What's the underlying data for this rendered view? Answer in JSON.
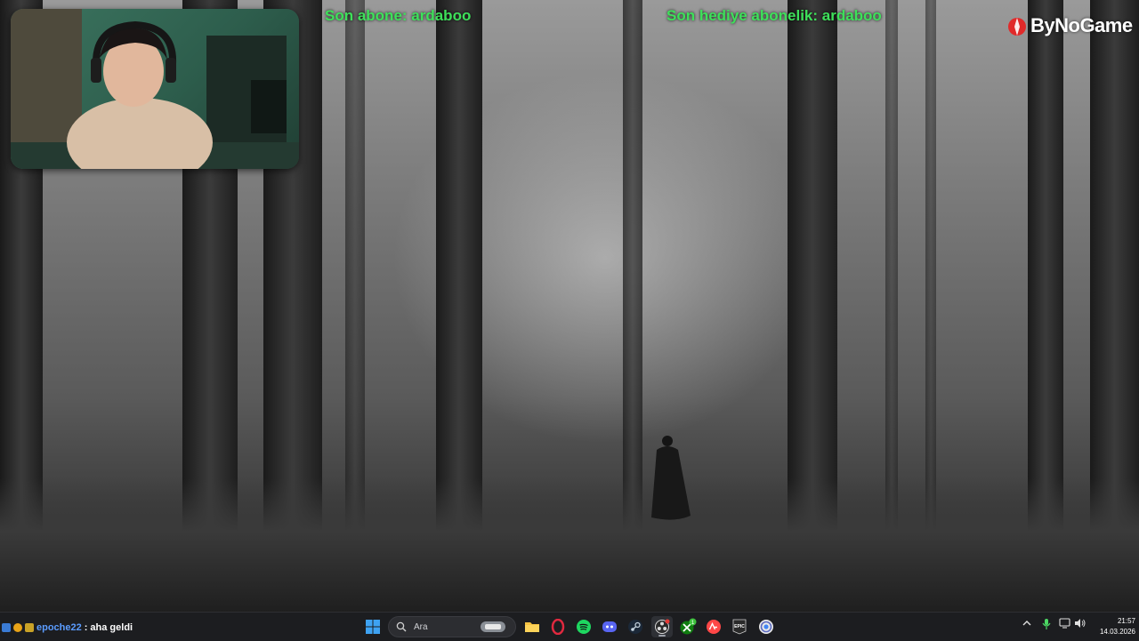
{
  "overlay": {
    "last_subscriber": "Son abone: ardaboo",
    "last_gift_sub": "Son hediye abonelik: ardaboo",
    "logo_text": "ByNoGame",
    "text_color": "#3ee05a"
  },
  "chat": {
    "username": "epoche22",
    "separator": ":",
    "message": "aha geldi"
  },
  "taskbar": {
    "search_placeholder": "Ara",
    "apps": [
      {
        "name": "start-menu-icon"
      },
      {
        "name": "file-explorer-icon"
      },
      {
        "name": "opera-gx-icon"
      },
      {
        "name": "spotify-icon"
      },
      {
        "name": "discord-icon"
      },
      {
        "name": "steam-icon"
      },
      {
        "name": "obs-studio-icon"
      },
      {
        "name": "xbox-icon"
      },
      {
        "name": "ea-app-icon"
      },
      {
        "name": "epic-games-icon"
      },
      {
        "name": "chrome-icon"
      }
    ],
    "epic_label": "EPIC",
    "xbox_badge": "1",
    "time": "21:57",
    "date": "14.03.2026"
  }
}
